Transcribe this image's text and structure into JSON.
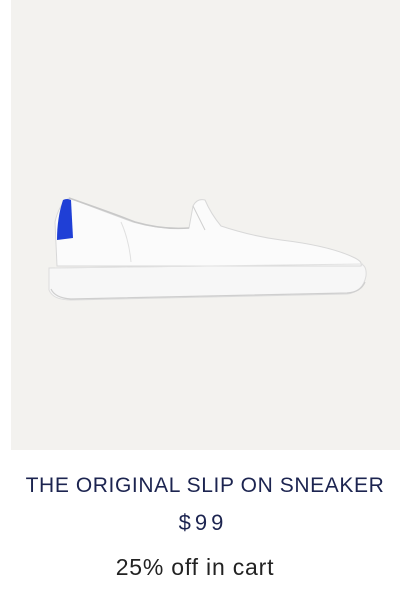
{
  "product": {
    "image_icon": "slip-on-sneaker-image",
    "title": "THE ORIGINAL SLIP ON SNEAKER",
    "price": "$99",
    "promo": "25% off in cart"
  },
  "colors": {
    "image_background": "#f3f2ef",
    "title_text": "#1c2450",
    "accent_heel": "#1f3fd6"
  }
}
